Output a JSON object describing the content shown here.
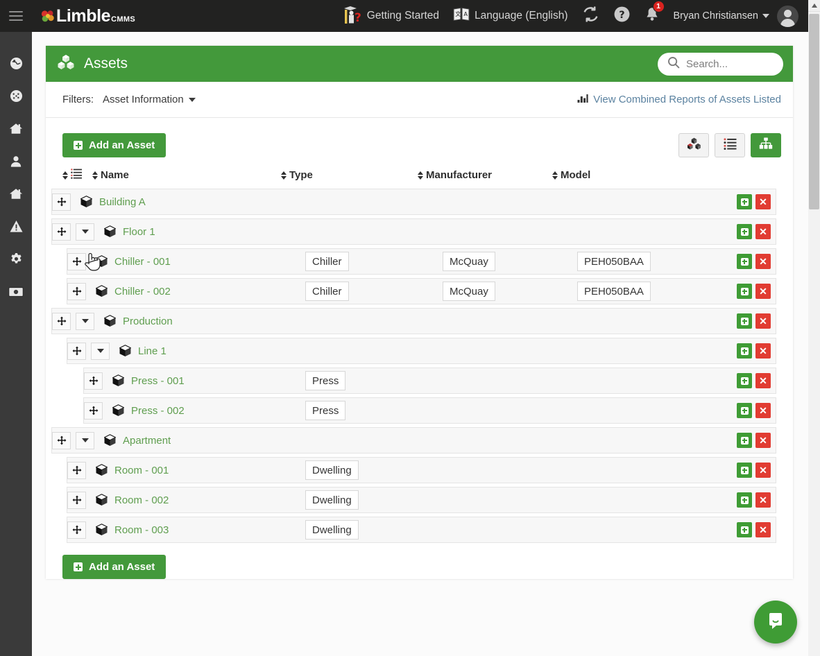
{
  "app": {
    "brand_name": "Limble",
    "brand_suffix": "CMMS",
    "menu_icon": "hamburger-icon",
    "logo_icon": "limble-flower-logo"
  },
  "topbar": {
    "getting_started": {
      "label": "Getting Started",
      "icon": "graduate-question-icon"
    },
    "language": {
      "label": "Language (English)",
      "icon": "translate-icon"
    },
    "refresh": {
      "icon": "refresh-icon"
    },
    "help": {
      "icon": "question-circle-icon"
    },
    "notifications": {
      "icon": "bell-icon",
      "badge": "1"
    },
    "user": {
      "name": "Bryan Christiansen",
      "caret": "chevron-down-icon",
      "avatar": "user-avatar"
    }
  },
  "sidebar": {
    "items": [
      {
        "name": "globe-icon"
      },
      {
        "name": "dashboard-gauge-icon"
      },
      {
        "name": "home-icon"
      },
      {
        "name": "user-icon"
      },
      {
        "name": "home-alt-icon"
      },
      {
        "name": "warning-triangle-icon"
      },
      {
        "name": "gear-icon"
      },
      {
        "name": "money-icon"
      }
    ]
  },
  "page": {
    "title": "Assets",
    "title_icon": "assets-cubes-icon",
    "search": {
      "placeholder": "Search...",
      "value": "",
      "icon": "search-icon"
    }
  },
  "filters": {
    "label": "Filters:",
    "dropdown_label": "Asset Information",
    "dropdown_caret": "caret-down-icon",
    "reports_link": "View Combined Reports of Assets Listed",
    "reports_icon": "bar-chart-icon"
  },
  "toolbar": {
    "add_asset_label": "Add an Asset",
    "views": [
      {
        "name": "cubes-view-button",
        "icon": "cubes-icon",
        "active": false
      },
      {
        "name": "list-view-button",
        "icon": "list-icon",
        "active": false
      },
      {
        "name": "hierarchy-view-button",
        "icon": "sitemap-icon",
        "active": true
      }
    ]
  },
  "table": {
    "columns": [
      {
        "key": "order",
        "label": "",
        "icon": "reorder-list-icon",
        "sortable": true
      },
      {
        "key": "name",
        "label": "Name",
        "sortable": true
      },
      {
        "key": "type",
        "label": "Type",
        "sortable": true
      },
      {
        "key": "manufacturer",
        "label": "Manufacturer",
        "sortable": true
      },
      {
        "key": "model",
        "label": "Model",
        "sortable": true
      }
    ],
    "rows": [
      {
        "name": "Building A",
        "level": 0,
        "expandable": false,
        "type": "",
        "manufacturer": "",
        "model": ""
      },
      {
        "name": "Floor 1",
        "level": 0,
        "expandable": true,
        "type": "",
        "manufacturer": "",
        "model": ""
      },
      {
        "name": "Chiller - 001",
        "level": 1,
        "expandable": false,
        "type": "Chiller",
        "manufacturer": "McQuay",
        "model": "PEH050BAA"
      },
      {
        "name": "Chiller - 002",
        "level": 1,
        "expandable": false,
        "type": "Chiller",
        "manufacturer": "McQuay",
        "model": "PEH050BAA"
      },
      {
        "name": "Production",
        "level": 0,
        "expandable": true,
        "type": "",
        "manufacturer": "",
        "model": ""
      },
      {
        "name": "Line 1",
        "level": 1,
        "expandable": true,
        "type": "",
        "manufacturer": "",
        "model": ""
      },
      {
        "name": "Press - 001",
        "level": 2,
        "expandable": false,
        "type": "Press",
        "manufacturer": "",
        "model": ""
      },
      {
        "name": "Press - 002",
        "level": 2,
        "expandable": false,
        "type": "Press",
        "manufacturer": "",
        "model": ""
      },
      {
        "name": "Apartment",
        "level": 0,
        "expandable": true,
        "type": "",
        "manufacturer": "",
        "model": ""
      },
      {
        "name": "Room - 001",
        "level": 1,
        "expandable": false,
        "type": "Dwelling",
        "manufacturer": "",
        "model": ""
      },
      {
        "name": "Room - 002",
        "level": 1,
        "expandable": false,
        "type": "Dwelling",
        "manufacturer": "",
        "model": ""
      },
      {
        "name": "Room - 003",
        "level": 1,
        "expandable": false,
        "type": "Dwelling",
        "manufacturer": "",
        "model": ""
      }
    ],
    "row_actions": {
      "add": "add-child-button",
      "delete": "delete-row-button"
    }
  },
  "footer": {
    "add_asset_label": "Add an Asset"
  },
  "chat": {
    "icon": "chat-bubble-icon"
  },
  "scrollbar": {
    "name": "page-scrollbar"
  },
  "colors": {
    "brand_green": "#43993b",
    "action_green": "#3f9c35",
    "action_red": "#e13c32",
    "header_dark": "#222221",
    "rail_dark": "#3a3a3a",
    "link_blue": "#5b82a0",
    "asset_name_green": "#5f9e4f",
    "badge_red": "#d9231f"
  }
}
